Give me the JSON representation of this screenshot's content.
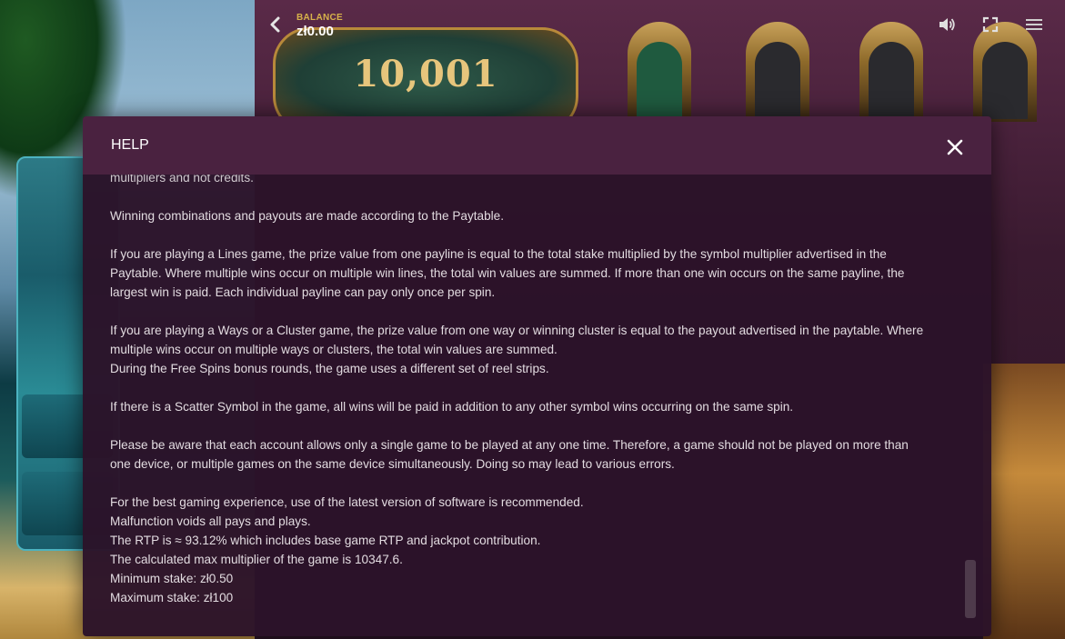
{
  "topbar": {
    "back_icon": "chevron-left-icon",
    "balance_label": "BALANCE",
    "balance_value": "zł0.00",
    "sound_icon": "speaker-icon",
    "fullscreen_icon": "fullscreen-icon",
    "menu_icon": "hamburger-menu-icon"
  },
  "game": {
    "logo_text": "10,001"
  },
  "help": {
    "title": "HELP",
    "close_icon": "close-icon",
    "cut_line": "multipliers and not credits.",
    "p1": "Winning combinations and payouts are made according to the Paytable.",
    "p2": [
      "If you are playing a Lines game, the prize value from one payline is equal to the total stake multiplied by the symbol multiplier advertised in the",
      "Paytable. Where multiple wins occur on multiple win lines, the total win values are summed. If more than one win occurs on the same payline, the",
      "largest win is paid. Each individual payline can pay only once per spin."
    ],
    "p3": [
      "If you are playing a Ways or a Cluster game, the prize value from one way or winning cluster is equal to the payout advertised in the paytable. Where",
      "multiple wins occur on multiple ways or clusters, the total win values are summed.",
      "During the Free Spins bonus rounds, the game uses a different set of reel strips."
    ],
    "p4": "If there is a Scatter Symbol in the game, all wins will be paid in addition to any other symbol wins occurring on the same spin.",
    "p5": [
      "Please be aware that each account allows only a single game to be played at any one time. Therefore, a game should not be played on more than",
      "one device, or multiple games on the same device simultaneously. Doing so may lead to various errors."
    ],
    "p6": [
      "For the best gaming experience, use of the latest version of software is recommended.",
      "Malfunction voids all pays and plays.",
      "The RTP is ≈ 93.12% which includes base game RTP and jackpot contribution.",
      "The calculated max multiplier of the game is 10347.6.",
      "Minimum stake: zł0.50",
      "Maximum stake: zł100"
    ]
  }
}
